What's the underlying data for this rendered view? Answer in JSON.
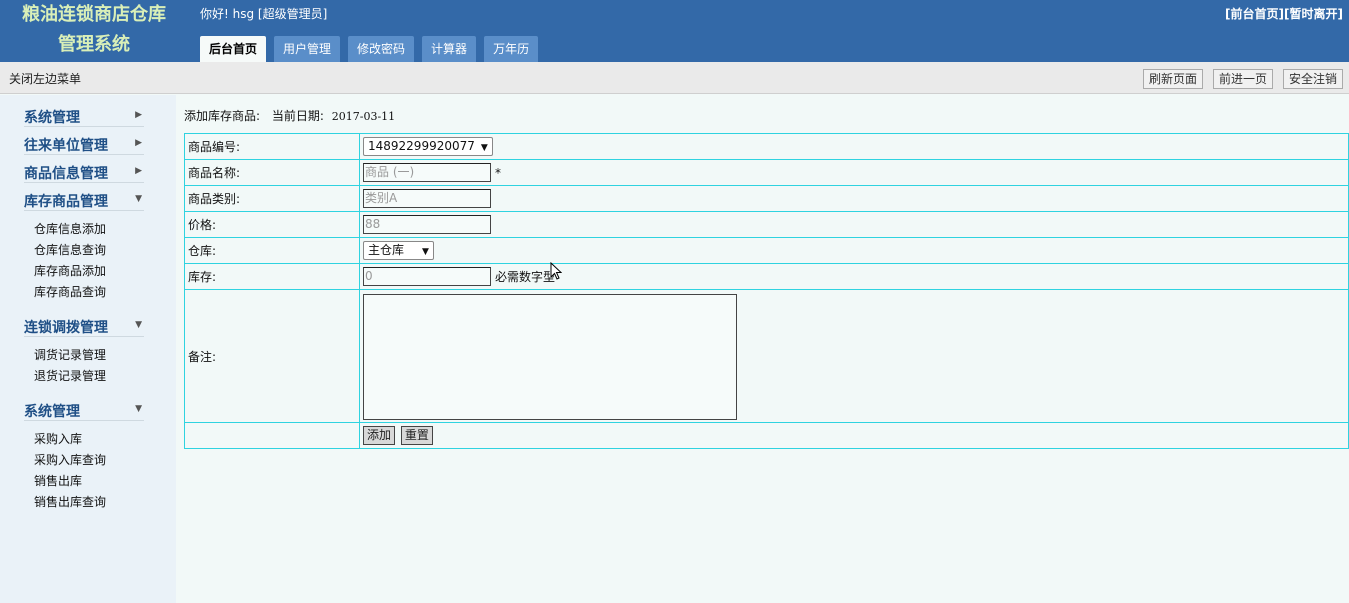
{
  "header": {
    "app_title": "粮油连锁商店仓库管理系统",
    "greeting": "你好! hsg [超级管理员]",
    "links": [
      {
        "label": "[前台首页]"
      },
      {
        "label": "[暂时离开]"
      }
    ],
    "tabs": [
      {
        "label": "后台首页",
        "active": true
      },
      {
        "label": "用户管理",
        "active": false
      },
      {
        "label": "修改密码",
        "active": false
      },
      {
        "label": "计算器",
        "active": false
      },
      {
        "label": "万年历",
        "active": false
      }
    ]
  },
  "toolbar": {
    "close_menu": "关闭左边菜单",
    "buttons": [
      {
        "label": "刷新页面"
      },
      {
        "label": "前进一页"
      },
      {
        "label": "安全注销"
      }
    ]
  },
  "sidebar": {
    "collapsed_groups": [
      {
        "label": "系统管理"
      },
      {
        "label": "往来单位管理"
      },
      {
        "label": "商品信息管理"
      }
    ],
    "expanded_groups": [
      {
        "label": "库存商品管理",
        "items": [
          "仓库信息添加",
          "仓库信息查询",
          "库存商品添加",
          "库存商品查询"
        ]
      },
      {
        "label": "连锁调拨管理",
        "items": [
          "调货记录管理",
          "退货记录管理"
        ]
      },
      {
        "label": "系统管理",
        "items": [
          "采购入库",
          "采购入库查询",
          "销售出库",
          "销售出库查询"
        ]
      }
    ]
  },
  "main": {
    "title": "添加库存商品:",
    "date_label": "当前日期:",
    "date_value": "2017-03-11",
    "form": {
      "product_code": {
        "label": "商品编号:",
        "value": "14892299920077"
      },
      "product_name": {
        "label": "商品名称:",
        "value": "商品 (一)",
        "required_mark": "*"
      },
      "category": {
        "label": "商品类别:",
        "value": "类别A"
      },
      "price": {
        "label": "价格:",
        "value": "88"
      },
      "warehouse": {
        "label": "仓库:",
        "value": "主仓库"
      },
      "stock": {
        "label": "库存:",
        "value": "0",
        "hint": "必需数字型"
      },
      "remark": {
        "label": "备注:",
        "value": ""
      },
      "submit_label": "添加",
      "reset_label": "重置"
    }
  },
  "colors": {
    "header_bg": "#3369a8",
    "tab_bg": "#5a8ec9",
    "table_border": "#2fd3e0",
    "menu_text": "#1f4f86"
  }
}
